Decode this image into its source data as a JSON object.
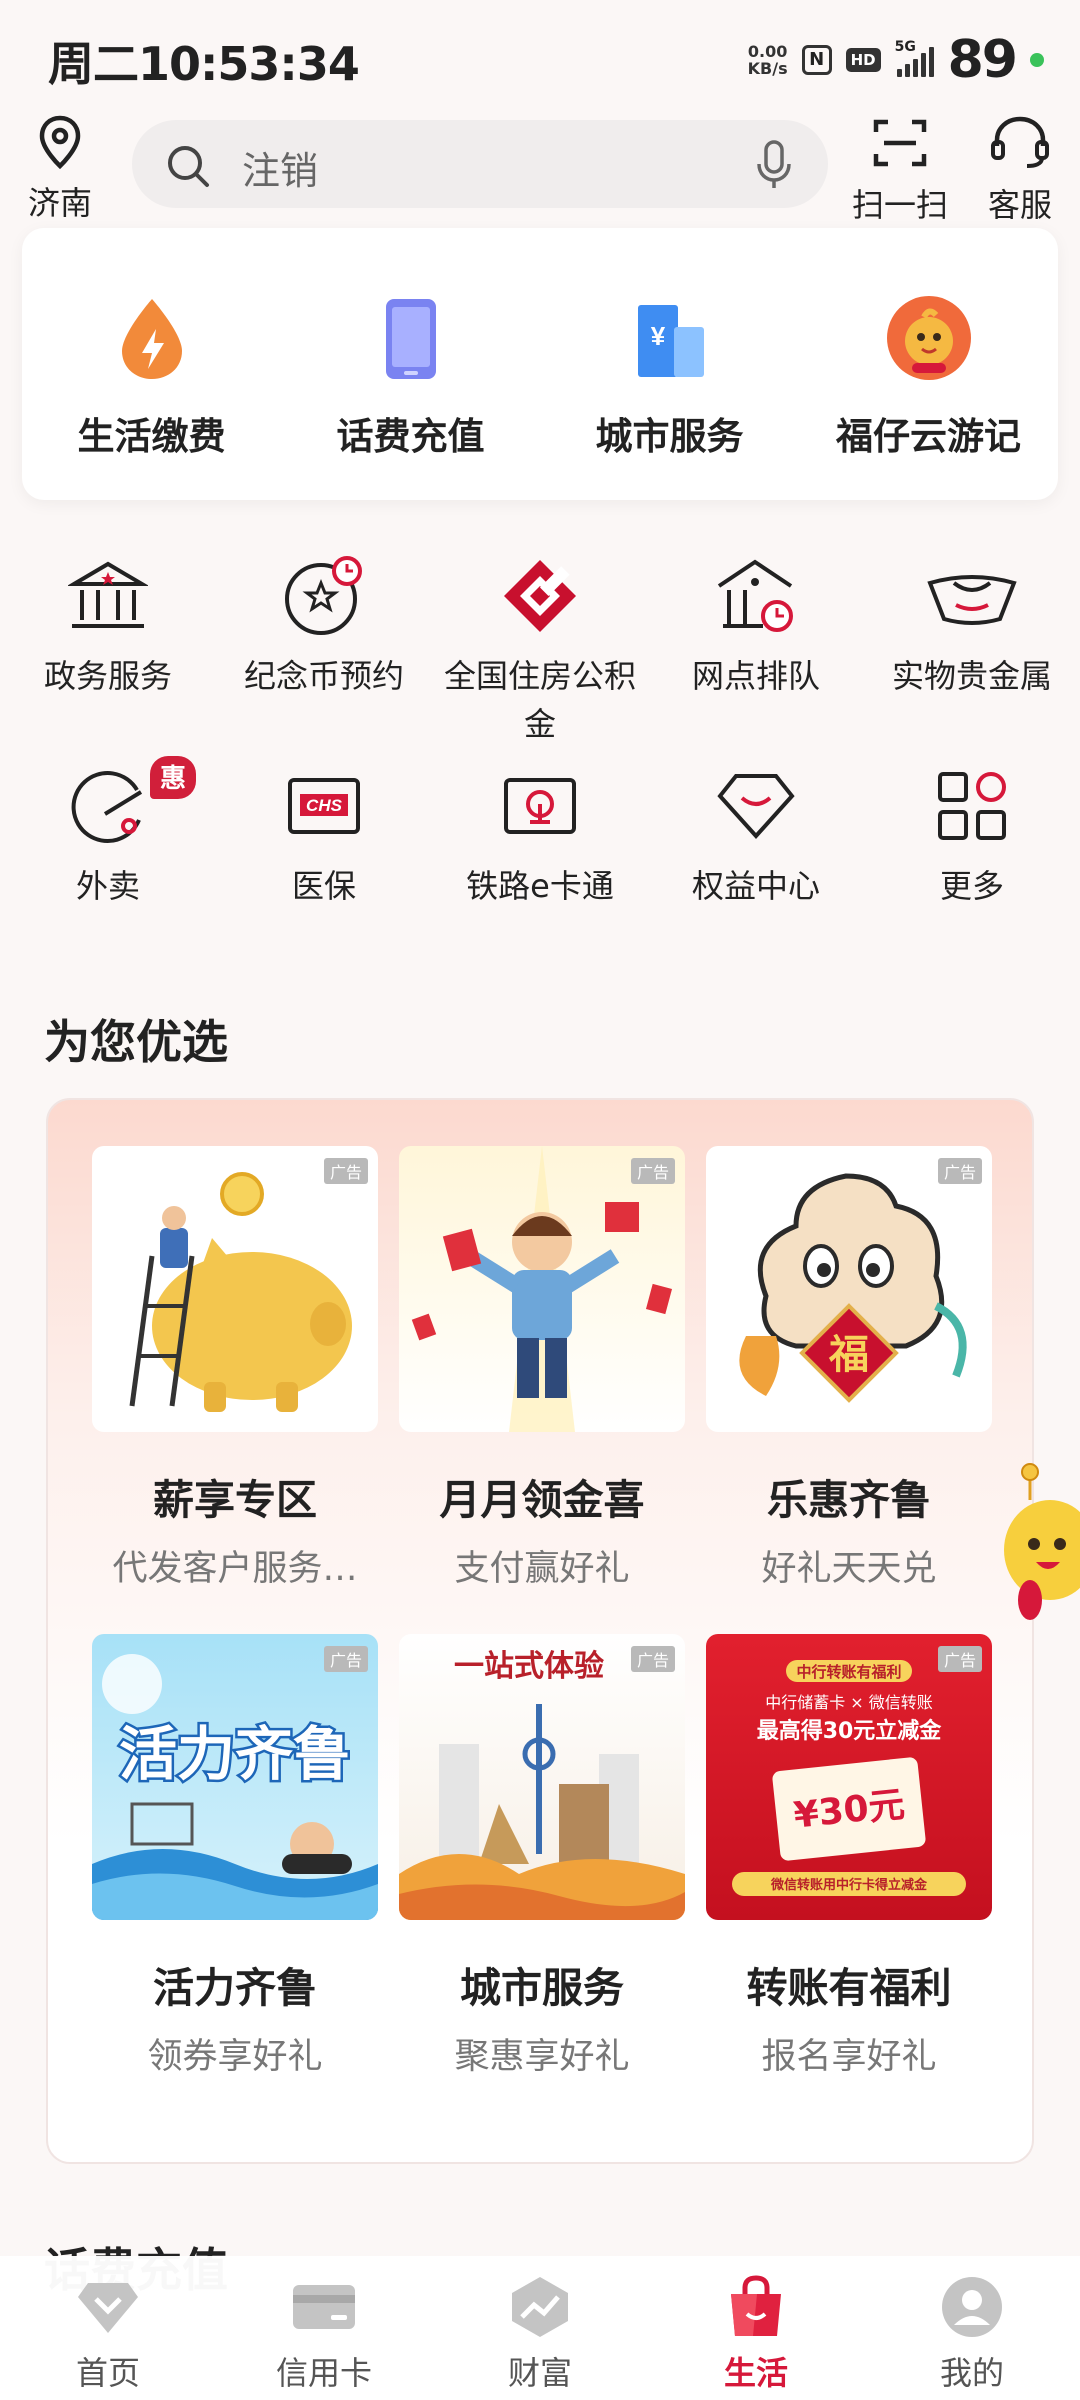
{
  "status": {
    "time": "周二10:53:34",
    "net_speed_value": "0.00",
    "net_speed_unit": "KB/s",
    "hd": "HD",
    "signal_type": "5G",
    "battery": "89",
    "nfc": "N"
  },
  "header": {
    "location": "济南",
    "search_placeholder": "注销",
    "scan_label": "扫一扫",
    "service_label": "客服"
  },
  "top_services": [
    {
      "label": "生活缴费",
      "icon": "lightning-drop-icon"
    },
    {
      "label": "话费充值",
      "icon": "phone-icon"
    },
    {
      "label": "城市服务",
      "icon": "city-building-icon"
    },
    {
      "label": "福仔云游记",
      "icon": "mascot-icon"
    }
  ],
  "grid_services": [
    {
      "label": "政务服务",
      "icon": "government-icon"
    },
    {
      "label": "纪念币预约",
      "icon": "coin-clock-icon"
    },
    {
      "label": "全国住房公积金",
      "icon": "housing-fund-icon"
    },
    {
      "label": "网点排队",
      "icon": "branch-queue-icon"
    },
    {
      "label": "实物贵金属",
      "icon": "gold-ingot-icon"
    },
    {
      "label": "外卖",
      "icon": "takeout-icon",
      "badge": "惠"
    },
    {
      "label": "医保",
      "icon": "chs-icon",
      "icon_text": "CHS"
    },
    {
      "label": "铁路e卡通",
      "icon": "railway-icon"
    },
    {
      "label": "权益中心",
      "icon": "diamond-icon"
    },
    {
      "label": "更多",
      "icon": "more-grid-icon"
    }
  ],
  "for_you": {
    "title": "为您优选",
    "ad_label": "广告",
    "cards": [
      {
        "title": "薪享专区",
        "subtitle": "代发客户服务…"
      },
      {
        "title": "月月领金喜",
        "subtitle": "支付赢好礼"
      },
      {
        "title": "乐惠齐鲁",
        "subtitle": "好礼天天兑"
      },
      {
        "title": "活力齐鲁",
        "subtitle": "领券享好礼",
        "image_text": "活力齐鲁"
      },
      {
        "title": "城市服务",
        "subtitle": "聚惠享好礼",
        "image_text": "一站式体验"
      },
      {
        "title": "转账有福利",
        "subtitle": "报名享好礼",
        "image_lines": [
          "中行转账有福利",
          "中行储蓄卡 × 微信转账",
          "最高得30元立减金",
          "¥30元",
          "微信转账用中行卡得立减金"
        ]
      }
    ]
  },
  "next_section_title": "话费充值",
  "bottom_nav": [
    {
      "label": "首页",
      "icon": "home-diamond-icon",
      "active": false
    },
    {
      "label": "信用卡",
      "icon": "credit-card-icon",
      "active": false
    },
    {
      "label": "财富",
      "icon": "wealth-chart-icon",
      "active": false
    },
    {
      "label": "生活",
      "icon": "shopping-bag-icon",
      "active": true
    },
    {
      "label": "我的",
      "icon": "profile-icon",
      "active": false
    }
  ],
  "colors": {
    "accent": "#d6183a",
    "background": "#fbf7f6"
  }
}
